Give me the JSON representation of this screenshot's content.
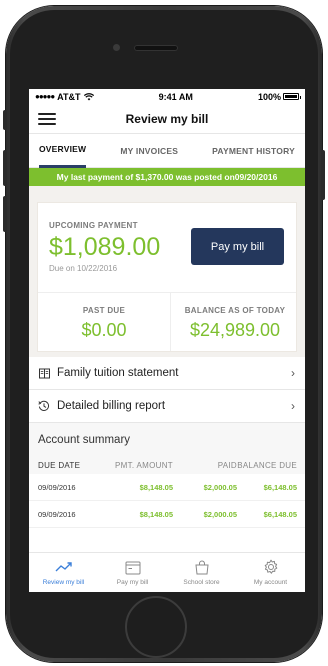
{
  "status_bar": {
    "carrier": "AT&T",
    "time": "9:41 AM",
    "battery": "100%"
  },
  "nav": {
    "title": "Review my bill"
  },
  "tabs": [
    {
      "label": "OVERVIEW",
      "active": true
    },
    {
      "label": "MY INVOICES",
      "active": false
    },
    {
      "label": "PAYMENT HISTORY",
      "active": false
    }
  ],
  "notice": {
    "text": "My last payment of $1,370.00 was posted on09/20/2016"
  },
  "summary": {
    "upcoming_label": "UPCOMING PAYMENT",
    "upcoming_amount": "$1,089.00",
    "due_text": "Due on 10/22/2016",
    "pay_button": "Pay my bill",
    "past_due_label": "PAST DUE",
    "past_due_value": "$0.00",
    "balance_label": "BALANCE AS OF TODAY",
    "balance_value": "$24,989.00"
  },
  "links": [
    {
      "label": "Family tuition statement",
      "icon": "document-icon"
    },
    {
      "label": "Detailed billing report",
      "icon": "history-icon"
    }
  ],
  "account_summary": {
    "title": "Account summary",
    "headers": [
      "DUE DATE",
      "PMT. AMOUNT",
      "PAID",
      "BALANCE DUE"
    ],
    "rows": [
      [
        "09/09/2016",
        "$8,148.05",
        "$2,000.05",
        "$6,148.05"
      ],
      [
        "09/09/2016",
        "$8,148.05",
        "$2,000.05",
        "$6,148.05"
      ]
    ]
  },
  "tabbar": [
    {
      "label": "Review my bill",
      "icon": "trend-chart-icon",
      "active": true
    },
    {
      "label": "Pay my bill",
      "icon": "wallet-icon",
      "active": false
    },
    {
      "label": "School store",
      "icon": "shopping-bag-icon",
      "active": false
    },
    {
      "label": "My account",
      "icon": "gear-icon",
      "active": false
    }
  ],
  "colors": {
    "accent_green": "#7dbf2e",
    "navy": "#24375c",
    "active_blue": "#3b7fd9"
  }
}
